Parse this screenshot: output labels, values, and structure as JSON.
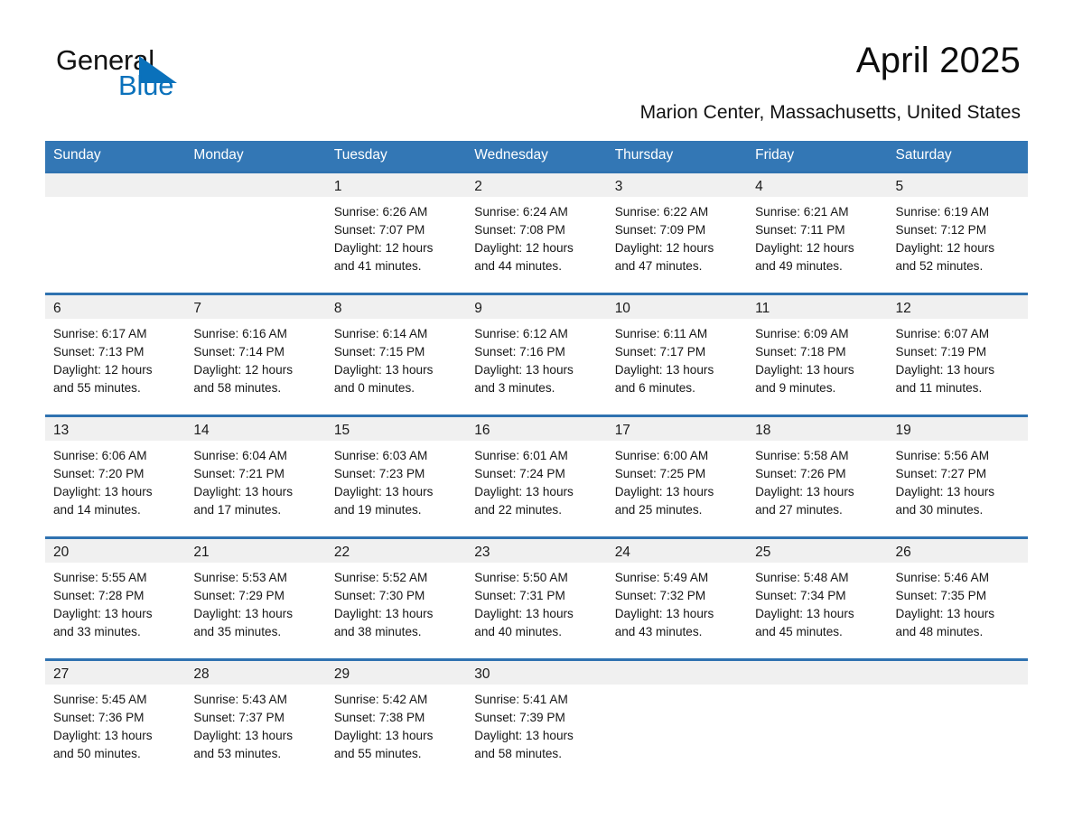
{
  "logo": {
    "text_top": "General",
    "text_bottom": "Blue",
    "triangle_icon": "logo-triangle-icon",
    "brand_color": "#0a71bb"
  },
  "header": {
    "title": "April 2025",
    "location": "Marion Center, Massachusetts, United States"
  },
  "theme": {
    "header_blue": "#3377b5",
    "row_border_blue": "#2f72b0",
    "daynum_strip_gray": "#f0f0f0"
  },
  "calendar": {
    "weekday_headers": [
      "Sunday",
      "Monday",
      "Tuesday",
      "Wednesday",
      "Thursday",
      "Friday",
      "Saturday"
    ],
    "weeks": [
      [
        {
          "day": "",
          "empty": true,
          "sunrise": "",
          "sunset": "",
          "daylight_line1": "",
          "daylight_line2": ""
        },
        {
          "day": "",
          "empty": true,
          "sunrise": "",
          "sunset": "",
          "daylight_line1": "",
          "daylight_line2": ""
        },
        {
          "day": "1",
          "sunrise": "Sunrise: 6:26 AM",
          "sunset": "Sunset: 7:07 PM",
          "daylight_line1": "Daylight: 12 hours",
          "daylight_line2": "and 41 minutes."
        },
        {
          "day": "2",
          "sunrise": "Sunrise: 6:24 AM",
          "sunset": "Sunset: 7:08 PM",
          "daylight_line1": "Daylight: 12 hours",
          "daylight_line2": "and 44 minutes."
        },
        {
          "day": "3",
          "sunrise": "Sunrise: 6:22 AM",
          "sunset": "Sunset: 7:09 PM",
          "daylight_line1": "Daylight: 12 hours",
          "daylight_line2": "and 47 minutes."
        },
        {
          "day": "4",
          "sunrise": "Sunrise: 6:21 AM",
          "sunset": "Sunset: 7:11 PM",
          "daylight_line1": "Daylight: 12 hours",
          "daylight_line2": "and 49 minutes."
        },
        {
          "day": "5",
          "sunrise": "Sunrise: 6:19 AM",
          "sunset": "Sunset: 7:12 PM",
          "daylight_line1": "Daylight: 12 hours",
          "daylight_line2": "and 52 minutes."
        }
      ],
      [
        {
          "day": "6",
          "sunrise": "Sunrise: 6:17 AM",
          "sunset": "Sunset: 7:13 PM",
          "daylight_line1": "Daylight: 12 hours",
          "daylight_line2": "and 55 minutes."
        },
        {
          "day": "7",
          "sunrise": "Sunrise: 6:16 AM",
          "sunset": "Sunset: 7:14 PM",
          "daylight_line1": "Daylight: 12 hours",
          "daylight_line2": "and 58 minutes."
        },
        {
          "day": "8",
          "sunrise": "Sunrise: 6:14 AM",
          "sunset": "Sunset: 7:15 PM",
          "daylight_line1": "Daylight: 13 hours",
          "daylight_line2": "and 0 minutes."
        },
        {
          "day": "9",
          "sunrise": "Sunrise: 6:12 AM",
          "sunset": "Sunset: 7:16 PM",
          "daylight_line1": "Daylight: 13 hours",
          "daylight_line2": "and 3 minutes."
        },
        {
          "day": "10",
          "sunrise": "Sunrise: 6:11 AM",
          "sunset": "Sunset: 7:17 PM",
          "daylight_line1": "Daylight: 13 hours",
          "daylight_line2": "and 6 minutes."
        },
        {
          "day": "11",
          "sunrise": "Sunrise: 6:09 AM",
          "sunset": "Sunset: 7:18 PM",
          "daylight_line1": "Daylight: 13 hours",
          "daylight_line2": "and 9 minutes."
        },
        {
          "day": "12",
          "sunrise": "Sunrise: 6:07 AM",
          "sunset": "Sunset: 7:19 PM",
          "daylight_line1": "Daylight: 13 hours",
          "daylight_line2": "and 11 minutes."
        }
      ],
      [
        {
          "day": "13",
          "sunrise": "Sunrise: 6:06 AM",
          "sunset": "Sunset: 7:20 PM",
          "daylight_line1": "Daylight: 13 hours",
          "daylight_line2": "and 14 minutes."
        },
        {
          "day": "14",
          "sunrise": "Sunrise: 6:04 AM",
          "sunset": "Sunset: 7:21 PM",
          "daylight_line1": "Daylight: 13 hours",
          "daylight_line2": "and 17 minutes."
        },
        {
          "day": "15",
          "sunrise": "Sunrise: 6:03 AM",
          "sunset": "Sunset: 7:23 PM",
          "daylight_line1": "Daylight: 13 hours",
          "daylight_line2": "and 19 minutes."
        },
        {
          "day": "16",
          "sunrise": "Sunrise: 6:01 AM",
          "sunset": "Sunset: 7:24 PM",
          "daylight_line1": "Daylight: 13 hours",
          "daylight_line2": "and 22 minutes."
        },
        {
          "day": "17",
          "sunrise": "Sunrise: 6:00 AM",
          "sunset": "Sunset: 7:25 PM",
          "daylight_line1": "Daylight: 13 hours",
          "daylight_line2": "and 25 minutes."
        },
        {
          "day": "18",
          "sunrise": "Sunrise: 5:58 AM",
          "sunset": "Sunset: 7:26 PM",
          "daylight_line1": "Daylight: 13 hours",
          "daylight_line2": "and 27 minutes."
        },
        {
          "day": "19",
          "sunrise": "Sunrise: 5:56 AM",
          "sunset": "Sunset: 7:27 PM",
          "daylight_line1": "Daylight: 13 hours",
          "daylight_line2": "and 30 minutes."
        }
      ],
      [
        {
          "day": "20",
          "sunrise": "Sunrise: 5:55 AM",
          "sunset": "Sunset: 7:28 PM",
          "daylight_line1": "Daylight: 13 hours",
          "daylight_line2": "and 33 minutes."
        },
        {
          "day": "21",
          "sunrise": "Sunrise: 5:53 AM",
          "sunset": "Sunset: 7:29 PM",
          "daylight_line1": "Daylight: 13 hours",
          "daylight_line2": "and 35 minutes."
        },
        {
          "day": "22",
          "sunrise": "Sunrise: 5:52 AM",
          "sunset": "Sunset: 7:30 PM",
          "daylight_line1": "Daylight: 13 hours",
          "daylight_line2": "and 38 minutes."
        },
        {
          "day": "23",
          "sunrise": "Sunrise: 5:50 AM",
          "sunset": "Sunset: 7:31 PM",
          "daylight_line1": "Daylight: 13 hours",
          "daylight_line2": "and 40 minutes."
        },
        {
          "day": "24",
          "sunrise": "Sunrise: 5:49 AM",
          "sunset": "Sunset: 7:32 PM",
          "daylight_line1": "Daylight: 13 hours",
          "daylight_line2": "and 43 minutes."
        },
        {
          "day": "25",
          "sunrise": "Sunrise: 5:48 AM",
          "sunset": "Sunset: 7:34 PM",
          "daylight_line1": "Daylight: 13 hours",
          "daylight_line2": "and 45 minutes."
        },
        {
          "day": "26",
          "sunrise": "Sunrise: 5:46 AM",
          "sunset": "Sunset: 7:35 PM",
          "daylight_line1": "Daylight: 13 hours",
          "daylight_line2": "and 48 minutes."
        }
      ],
      [
        {
          "day": "27",
          "sunrise": "Sunrise: 5:45 AM",
          "sunset": "Sunset: 7:36 PM",
          "daylight_line1": "Daylight: 13 hours",
          "daylight_line2": "and 50 minutes."
        },
        {
          "day": "28",
          "sunrise": "Sunrise: 5:43 AM",
          "sunset": "Sunset: 7:37 PM",
          "daylight_line1": "Daylight: 13 hours",
          "daylight_line2": "and 53 minutes."
        },
        {
          "day": "29",
          "sunrise": "Sunrise: 5:42 AM",
          "sunset": "Sunset: 7:38 PM",
          "daylight_line1": "Daylight: 13 hours",
          "daylight_line2": "and 55 minutes."
        },
        {
          "day": "30",
          "sunrise": "Sunrise: 5:41 AM",
          "sunset": "Sunset: 7:39 PM",
          "daylight_line1": "Daylight: 13 hours",
          "daylight_line2": "and 58 minutes."
        },
        {
          "day": "",
          "empty": true,
          "sunrise": "",
          "sunset": "",
          "daylight_line1": "",
          "daylight_line2": ""
        },
        {
          "day": "",
          "empty": true,
          "sunrise": "",
          "sunset": "",
          "daylight_line1": "",
          "daylight_line2": ""
        },
        {
          "day": "",
          "empty": true,
          "sunrise": "",
          "sunset": "",
          "daylight_line1": "",
          "daylight_line2": ""
        }
      ]
    ]
  }
}
